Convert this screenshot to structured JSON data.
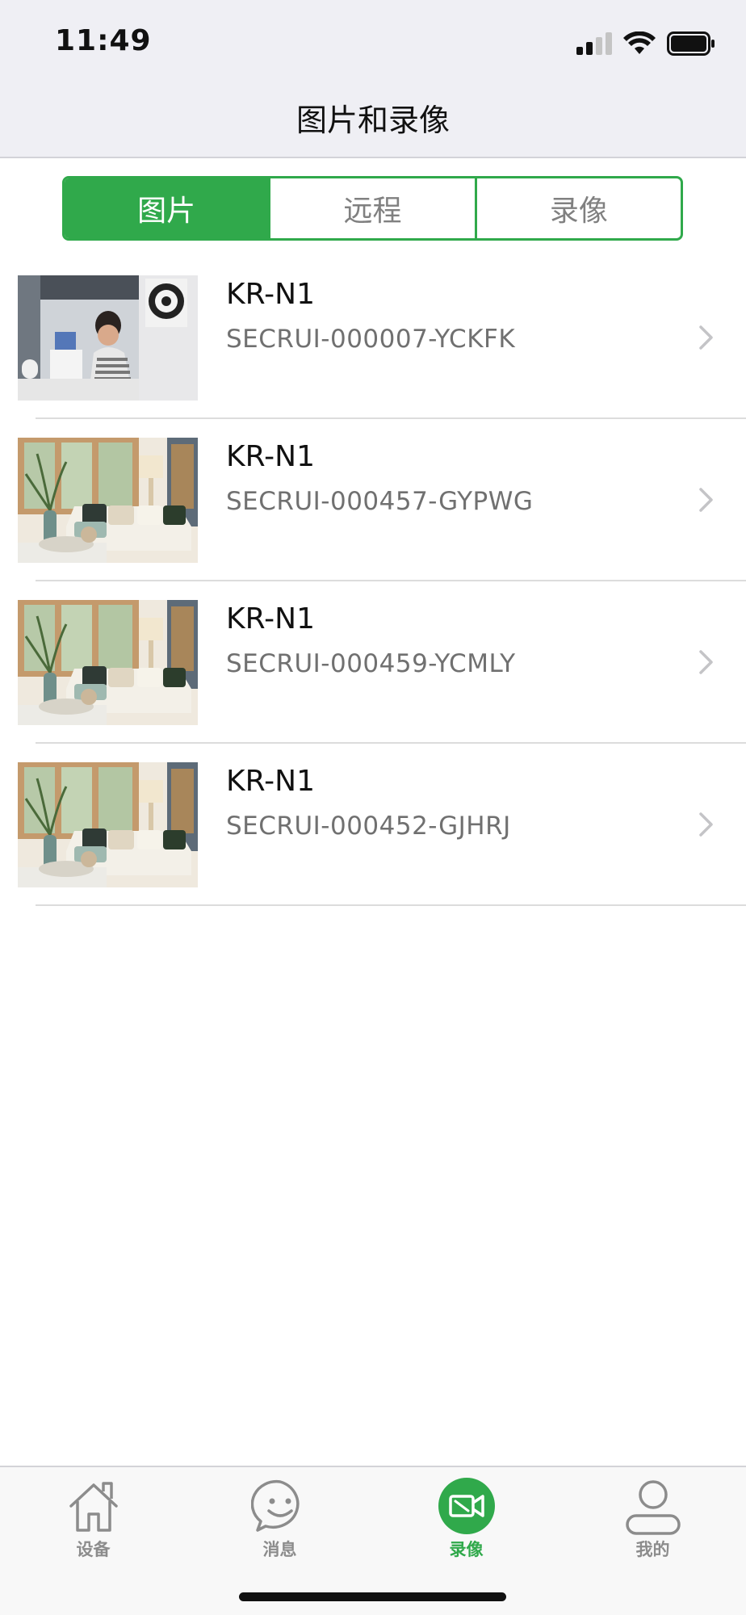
{
  "status_bar": {
    "time": "11:49"
  },
  "nav": {
    "title": "图片和录像"
  },
  "segmented": {
    "tabs": [
      {
        "label": "图片",
        "active": true
      },
      {
        "label": "远程",
        "active": false
      },
      {
        "label": "录像",
        "active": false
      }
    ]
  },
  "list": {
    "items": [
      {
        "title": "KR-N1",
        "subtitle": "SECRUI-000007-YCKFK",
        "thumbnail": "office-photo"
      },
      {
        "title": "KR-N1",
        "subtitle": "SECRUI-000457-GYPWG",
        "thumbnail": "living-room-photo"
      },
      {
        "title": "KR-N1",
        "subtitle": "SECRUI-000459-YCMLY",
        "thumbnail": "living-room-photo"
      },
      {
        "title": "KR-N1",
        "subtitle": "SECRUI-000452-GJHRJ",
        "thumbnail": "living-room-photo"
      }
    ]
  },
  "tabbar": {
    "items": [
      {
        "label": "设备",
        "icon": "home-icon",
        "active": false
      },
      {
        "label": "消息",
        "icon": "smiley-chat-icon",
        "active": false
      },
      {
        "label": "录像",
        "icon": "video-camera-icon",
        "active": true
      },
      {
        "label": "我的",
        "icon": "user-icon",
        "active": false
      }
    ]
  },
  "colors": {
    "accent": "#30a94b",
    "inactive_text": "#8c8c8c",
    "bar_background": "#efeff4"
  }
}
